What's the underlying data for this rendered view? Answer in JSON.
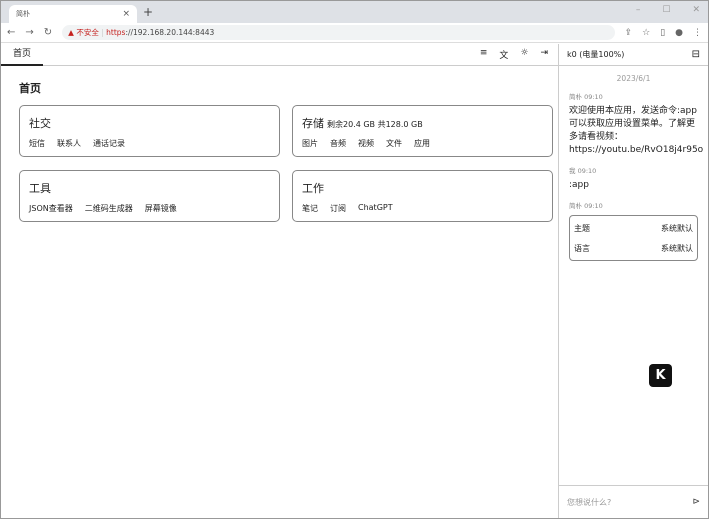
{
  "browser": {
    "tab_title": "简朴",
    "not_secure": "不安全",
    "url_scheme": "https",
    "url_rest": "://192.168.20.144:8443"
  },
  "main": {
    "tab": "首页",
    "title": "首页",
    "cards": [
      {
        "title": "社交",
        "extra": "",
        "links": [
          "短信",
          "联系人",
          "通话记录"
        ]
      },
      {
        "title": "存储",
        "extra": "剩余20.4 GB 共128.0 GB",
        "links": [
          "图片",
          "音频",
          "视频",
          "文件",
          "应用"
        ]
      },
      {
        "title": "工具",
        "extra": "",
        "links": [
          "JSON查看器",
          "二维码生成器",
          "屏幕镜像"
        ]
      },
      {
        "title": "工作",
        "extra": "",
        "links": [
          "笔记",
          "订阅",
          "ChatGPT"
        ]
      }
    ]
  },
  "side": {
    "header": "k0 (电量100%)",
    "date": "2023/6/1",
    "messages": [
      {
        "meta": "简朴 09:10",
        "text": "欢迎使用本应用，发送命令:app可以获取应用设置菜单。了解更多请看视频：https://youtu.be/RvO18j4r95o"
      },
      {
        "meta": "我 09:10",
        "text": ":app"
      },
      {
        "meta": "简朴 09:10"
      }
    ],
    "settings": [
      {
        "k": "主题",
        "v": "系统默认"
      },
      {
        "k": "语言",
        "v": "系统默认"
      }
    ],
    "logo": "K",
    "placeholder": "您想说什么?"
  }
}
